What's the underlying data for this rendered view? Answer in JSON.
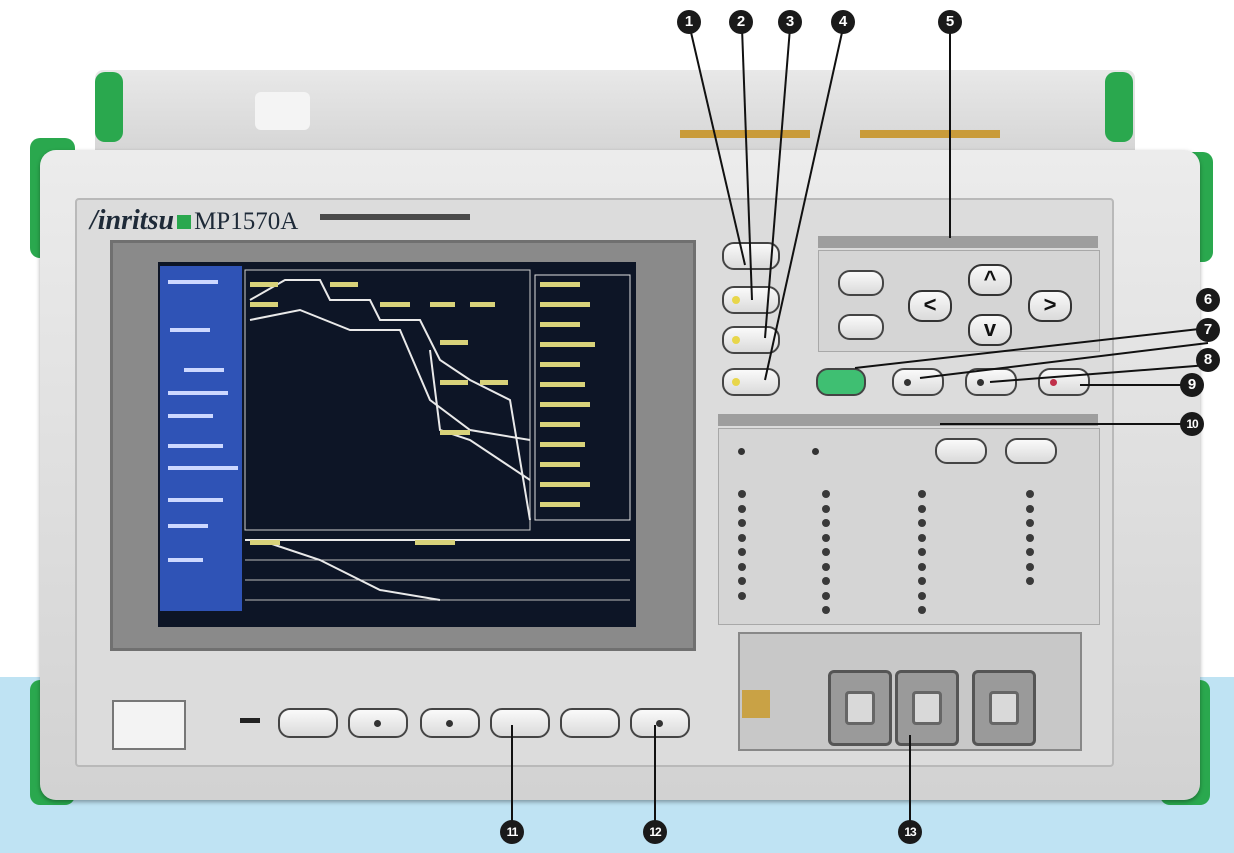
{
  "brand": {
    "name": "/inritsu",
    "model": "MP1570A"
  },
  "callouts": [
    "1",
    "2",
    "3",
    "4",
    "5",
    "6",
    "7",
    "8",
    "9",
    "10",
    "11",
    "12",
    "13"
  ],
  "colors": {
    "accent": "#2aa84e",
    "background_band": "#bfe3f3",
    "screen": "#0d1526",
    "screen_panel": "#2f53b6"
  }
}
